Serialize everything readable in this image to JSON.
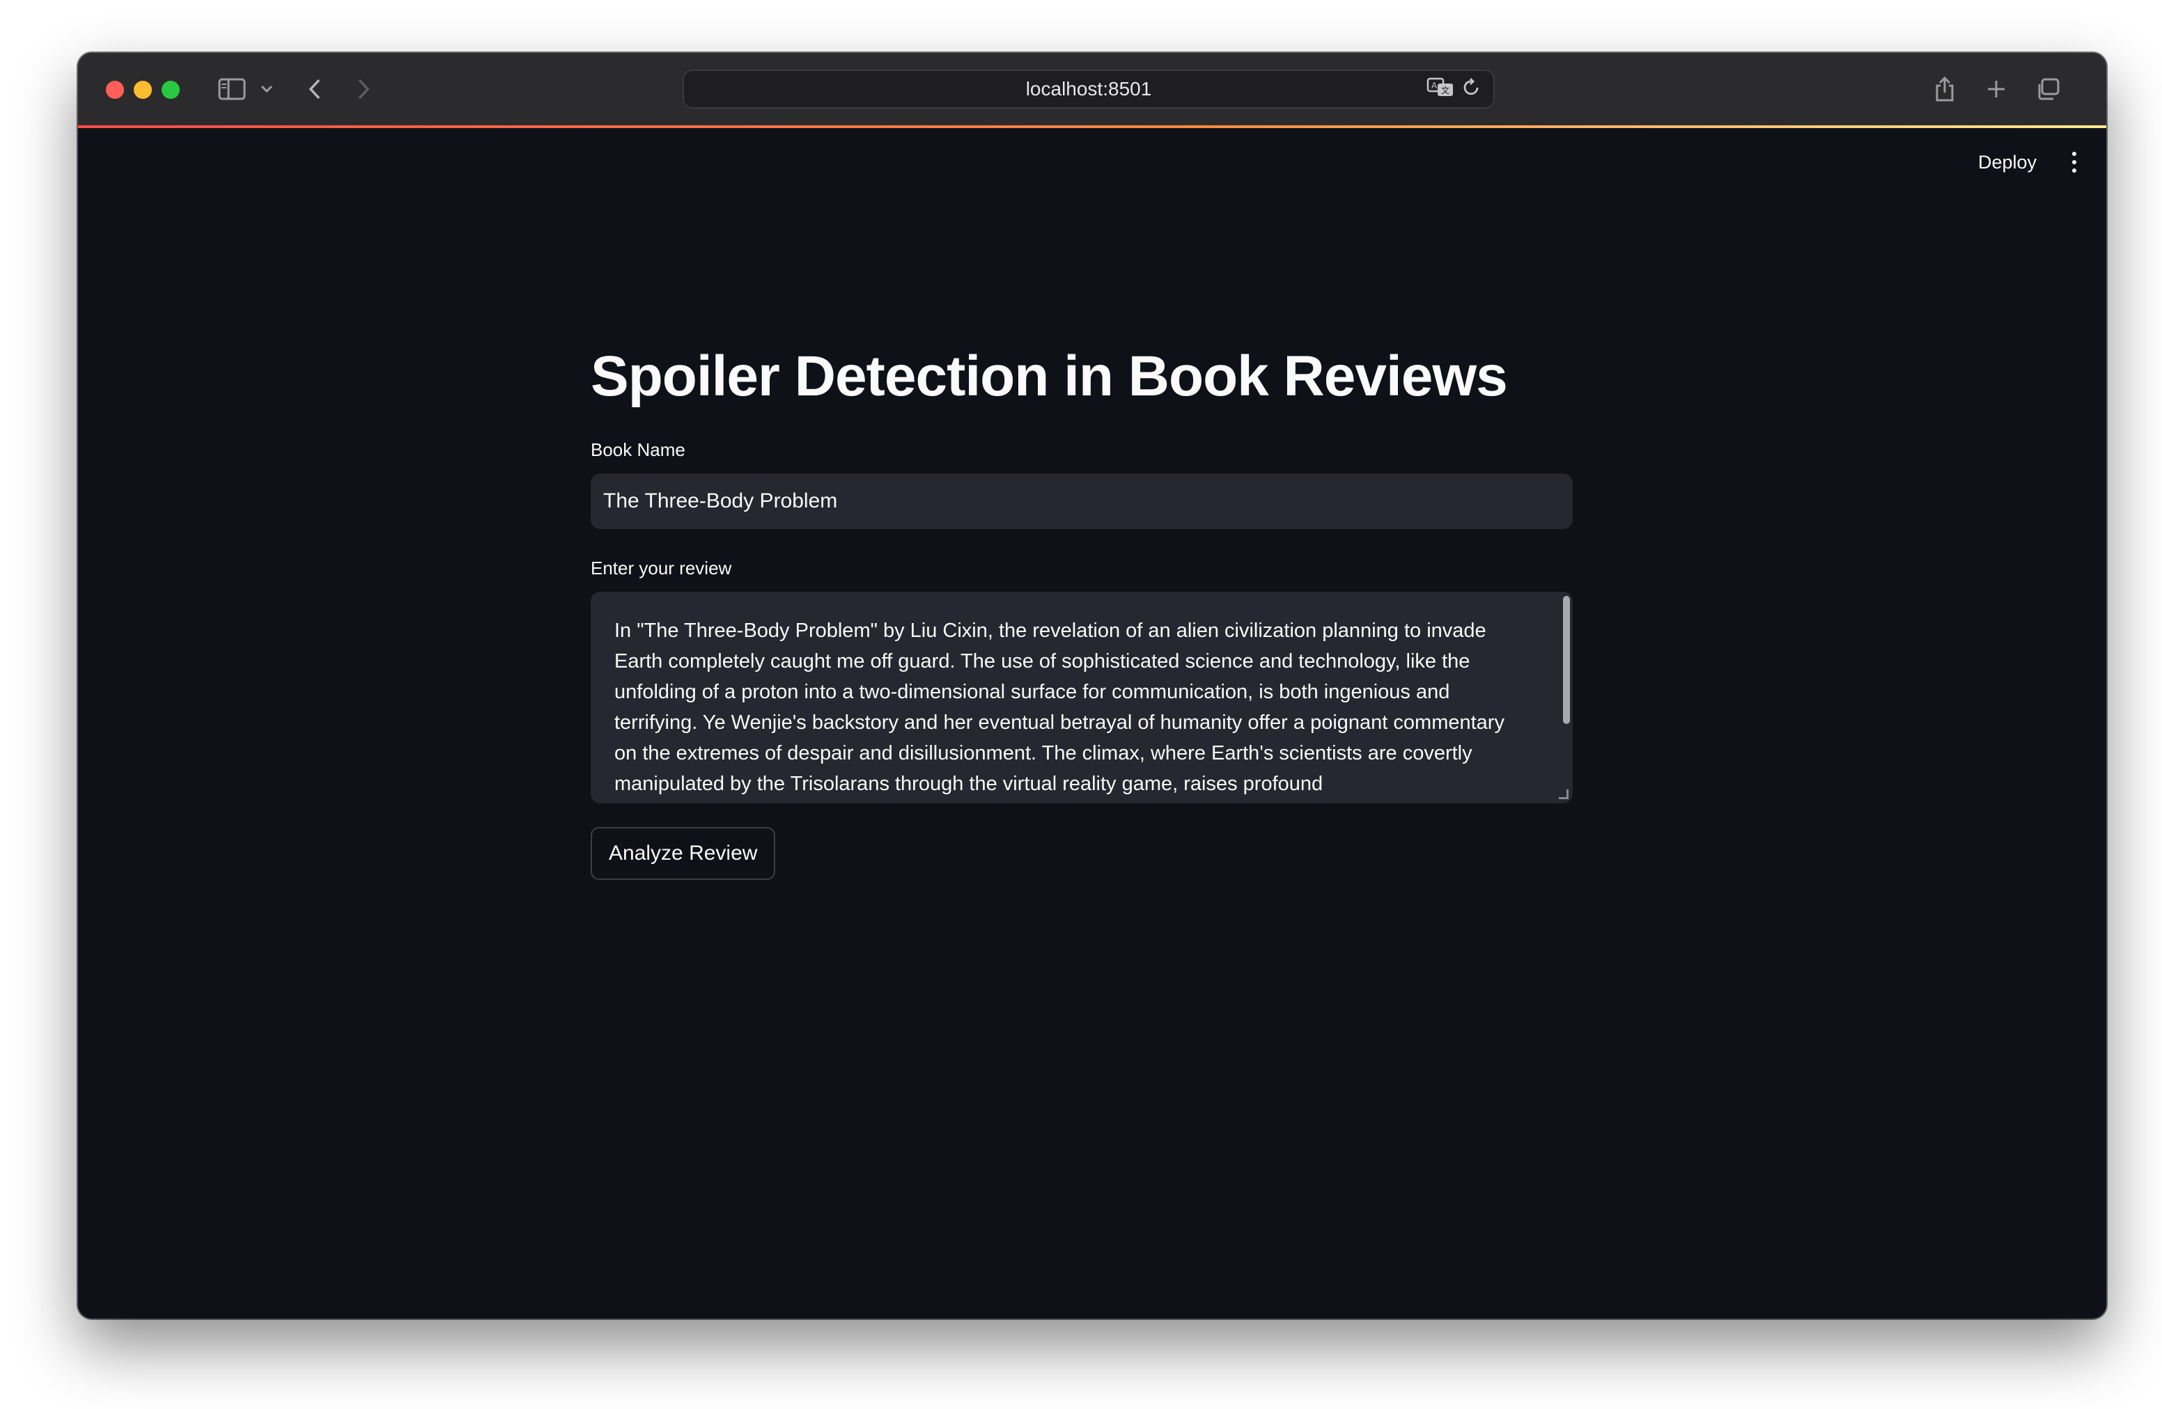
{
  "browser": {
    "url": "localhost:8501"
  },
  "header": {
    "deploy_label": "Deploy"
  },
  "main": {
    "title": "Spoiler Detection in Book Reviews",
    "book_name": {
      "label": "Book Name",
      "value": "The Three-Body Problem"
    },
    "review": {
      "label": "Enter your review",
      "value": "In \"The Three-Body Problem\" by Liu Cixin, the revelation of an alien civilization planning to invade Earth completely caught me off guard. The use of sophisticated science and technology, like the unfolding of a proton into a two-dimensional surface for communication, is both ingenious and terrifying. Ye Wenjie's backstory and her eventual betrayal of humanity offer a poignant commentary on the extremes of despair and disillusionment. The climax, where Earth's scientists are covertly manipulated by the Trisolarans through the virtual reality game, raises profound"
    },
    "analyze_button_label": "Analyze Review"
  }
}
